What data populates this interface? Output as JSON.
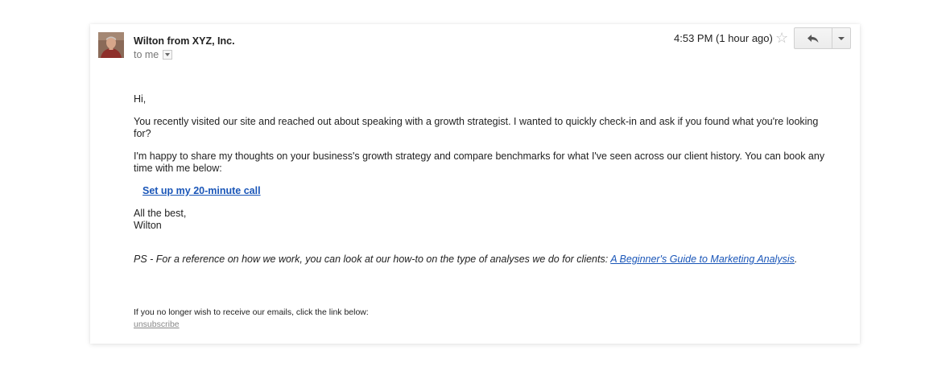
{
  "header": {
    "sender": "Wilton from XYZ, Inc.",
    "recipient": "to me",
    "time": "4:53 PM (1 hour ago)",
    "star_icon": "star-outline-icon",
    "reply_icon": "reply-arrow-icon",
    "more_icon": "caret-down-icon"
  },
  "body": {
    "greeting": "Hi,",
    "paragraph1": "You recently visited our site and reached out about speaking with a growth strategist. I wanted to quickly check-in and ask if you found what you're looking for?",
    "paragraph2": "I'm happy to share my thoughts on your business's growth strategy and compare benchmarks for what I've seen across our client history. You can book any time with me below:",
    "cta_label": "Set up my 20-minute call",
    "signoff_line1": "All the best,",
    "signoff_line2": "Wilton",
    "ps_text": "PS - For a reference on how we work, you can look at our how-to on the type of analyses we do for clients: ",
    "ps_link": "A Beginner's Guide to Marketing Analysis",
    "ps_end": "."
  },
  "footer": {
    "notice": "If you no longer wish to receive our emails, click the link below:",
    "unsubscribe": "unsubscribe"
  },
  "colors": {
    "link": "#1a56b8",
    "muted": "#777777",
    "star": "#bbbbbb"
  }
}
